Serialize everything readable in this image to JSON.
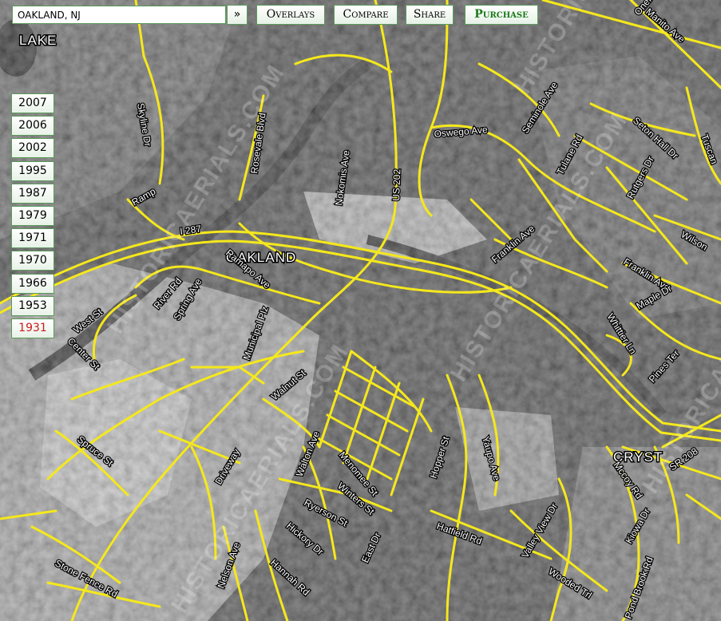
{
  "search": {
    "value": "OAKLAND, NJ"
  },
  "toolbar": {
    "go_label": "»",
    "overlays_label": "Overlays",
    "compare_label": "Compare",
    "share_label": "Share",
    "purchase_label": "Purchase"
  },
  "years": [
    "2007",
    "2006",
    "2002",
    "1995",
    "1987",
    "1979",
    "1971",
    "1970",
    "1966",
    "1953",
    "1931"
  ],
  "selected_year": "1931",
  "colors": {
    "roads": "#f5e81c",
    "button_border": "#5c9a5c",
    "selected_year": "#cc1a1a",
    "purchase": "#1a7a1a"
  },
  "map": {
    "place_labels": [
      "OAKLAND",
      "LAKE",
      "CRYST"
    ],
    "watermark": "HISTORICAERIALS.COM",
    "road_labels": [
      "Skyline Dr",
      "Ramp",
      "I 287",
      "Rosevale Blvd",
      "Nokomis Ave",
      "US 202",
      "Oswego Ave",
      "Seminole Ave",
      "Tulane Rd",
      "Seton Hall Dr",
      "Rutgers Dr",
      "Franklin Ave",
      "Wilson",
      "Maple Dr",
      "Whittier Ln",
      "Pines Ter",
      "Ramapo Ave",
      "River Rd",
      "Spring Ave",
      "Municipal Plz",
      "West St",
      "Center St",
      "Walnut St",
      "Walton Ave",
      "Menomee St",
      "Winters St",
      "Ryerson St",
      "Hopper St",
      "Yaupo Ave",
      "Driveway",
      "Spruce St",
      "Nelson Ave",
      "Hickory Dr",
      "Hannah Rd",
      "East Dr",
      "Hatfield Rd",
      "Valley View Dr",
      "Wooded Trl",
      "Mccoy Rd",
      "Kiowa Dr",
      "Pond Brook Rd",
      "SR 208",
      "Stone Fence Rd",
      "Oneida Ave",
      "Manito Ave",
      "Tuscan"
    ]
  }
}
